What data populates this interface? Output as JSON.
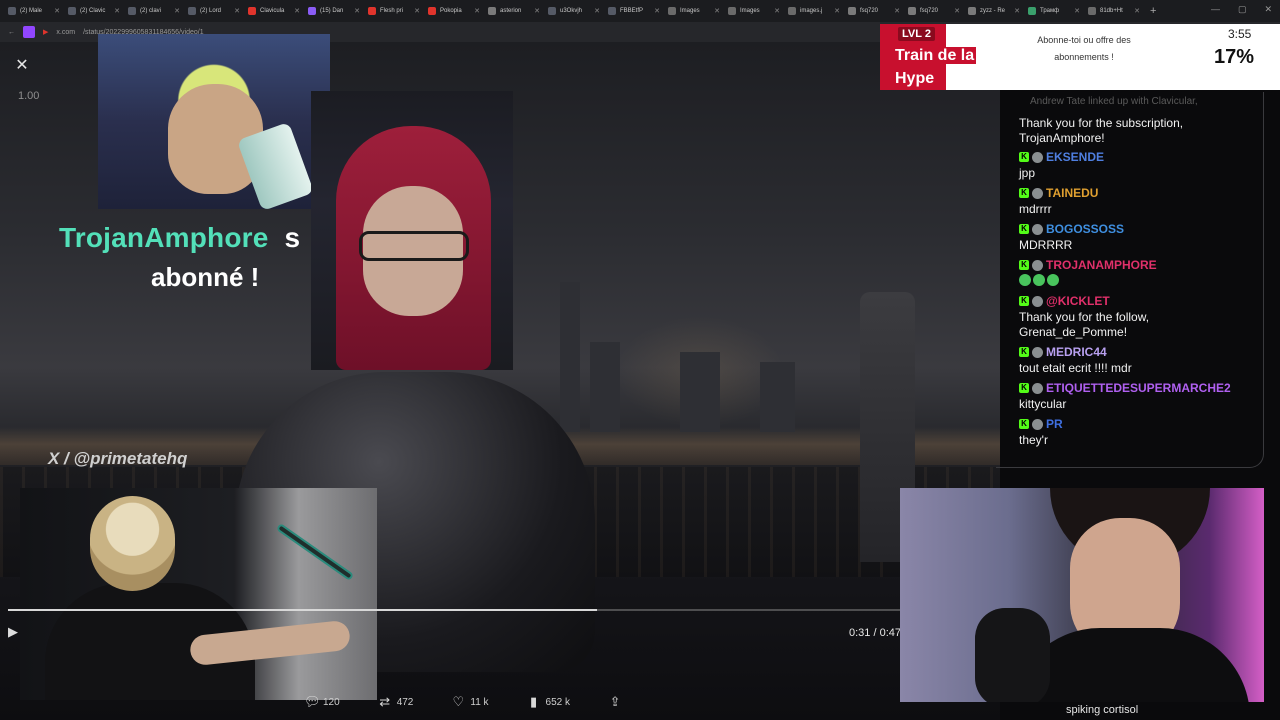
{
  "browser": {
    "tabs": [
      "(2) Male",
      "(2) Clavic",
      "(2) clavi",
      "(2) Lord",
      "Clavicula",
      "(15) Dan",
      "Flesh pri",
      "Pokopia",
      "asterion",
      "u3Okvjh",
      "FBBEtfP",
      "Images",
      "Images",
      "images.j",
      "fsq720",
      "fsq720",
      "zyzz - Re",
      "Трамф",
      "81db+Ht"
    ],
    "tab_colors": [
      "#555a66",
      "#555a66",
      "#555a66",
      "#555a66",
      "#e0342c",
      "#8a5cf6",
      "#e0342c",
      "#e0342c",
      "#7a7a7a",
      "#555a66",
      "#555a66",
      "#6a6a6a",
      "#6a6a6a",
      "#6a6a6a",
      "#7a7a7a",
      "#7a7a7a",
      "#7a7a7a",
      "#3aa06c",
      "#6a6a6a"
    ],
    "address_fragment": "x.com",
    "status_fragment": "/status/2022999605831184656/video/1"
  },
  "video": {
    "playback_speed": "1.00",
    "time_display": "0:31 / 0:47",
    "progress": 0.66,
    "watermark_handle": "X / @primetatehq"
  },
  "alert": {
    "username": "TrojanAmphore",
    "username_suffix": "s",
    "line2": "abonné !"
  },
  "actions": {
    "replies": "120",
    "reposts": "472",
    "likes": "11 k",
    "views": "652 k"
  },
  "hype_train": {
    "level": "LVL 2",
    "title_line1": "Train de la",
    "title_line2": "Hype",
    "message": "Abonne-toi ou offre des abonnements !",
    "timer": "3:55",
    "percent": "17%",
    "accent_color": "#c8102e"
  },
  "chat": {
    "faded_top": "Andrew Tate linked up with Clavicular,",
    "messages": [
      {
        "user": "",
        "text": "Thank you for the subscription, TrojanAmphore!",
        "color": "#f2f2f2"
      },
      {
        "user": "EKSENDE",
        "text": "jpp",
        "color": "#4f7fe0"
      },
      {
        "user": "TAINEDU",
        "text": "mdrrrr",
        "color": "#e0a030"
      },
      {
        "user": "BOGOSSOSS",
        "text": "MDRRRR",
        "color": "#3f8fe0"
      },
      {
        "user": "TROJANAMPHORE",
        "text": "",
        "color": "#e0306a"
      },
      {
        "user": "@KICKLET",
        "text": "Thank you for the follow, Grenat_de_Pomme!",
        "color": "#e0306a"
      },
      {
        "user": "MEDRIC44",
        "text": "tout etait ecrit !!!! mdr",
        "color": "#b8a0f0"
      },
      {
        "user": "ETIQUETTEDESUPERMARCHE2",
        "text": "kittycular",
        "color": "#b060f0"
      },
      {
        "user": "PR",
        "text": "they'r",
        "color": "#3f6fe0"
      }
    ]
  },
  "stream": {
    "caption": "spiking cortisol"
  }
}
